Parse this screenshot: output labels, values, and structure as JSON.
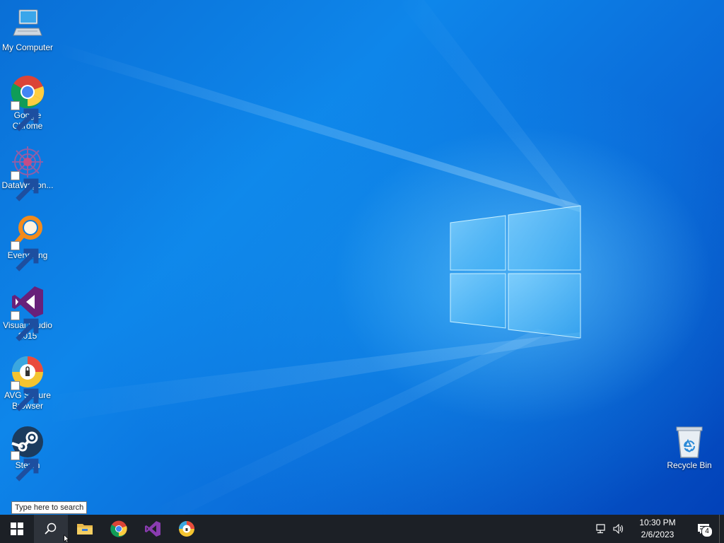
{
  "desktop": {
    "icons": [
      {
        "label": "My Computer",
        "icon": "computer-icon"
      },
      {
        "label": "Google\nChrome",
        "icon": "chrome-icon"
      },
      {
        "label": "DataWagon...",
        "icon": "datawagon-icon"
      },
      {
        "label": "Everything",
        "icon": "everything-search-icon"
      },
      {
        "label": "Visual Studio\n2015",
        "icon": "visual-studio-icon"
      },
      {
        "label": "AVG Secure\nBrowser",
        "icon": "avg-browser-icon"
      },
      {
        "label": "Steam",
        "icon": "steam-icon"
      }
    ],
    "recycle_bin": {
      "label": "Recycle Bin",
      "icon": "recycle-bin-icon"
    }
  },
  "tooltip": {
    "text": "Type here to search"
  },
  "taskbar": {
    "start": {
      "icon": "windows-start-icon"
    },
    "search": {
      "icon": "search-icon"
    },
    "pinned": [
      {
        "icon": "file-explorer-icon"
      },
      {
        "icon": "chrome-icon"
      },
      {
        "icon": "visual-studio-icon"
      },
      {
        "icon": "avg-browser-icon"
      }
    ],
    "tray": {
      "network_icon": "network-icon",
      "volume_icon": "volume-icon",
      "time": "10:30 PM",
      "date": "2/6/2023",
      "notifications_icon": "action-center-icon",
      "notification_count": "4"
    }
  },
  "colors": {
    "wallpaper": "#0a6fd6",
    "taskbar": "#1c2026",
    "accent": "#0078d7"
  }
}
